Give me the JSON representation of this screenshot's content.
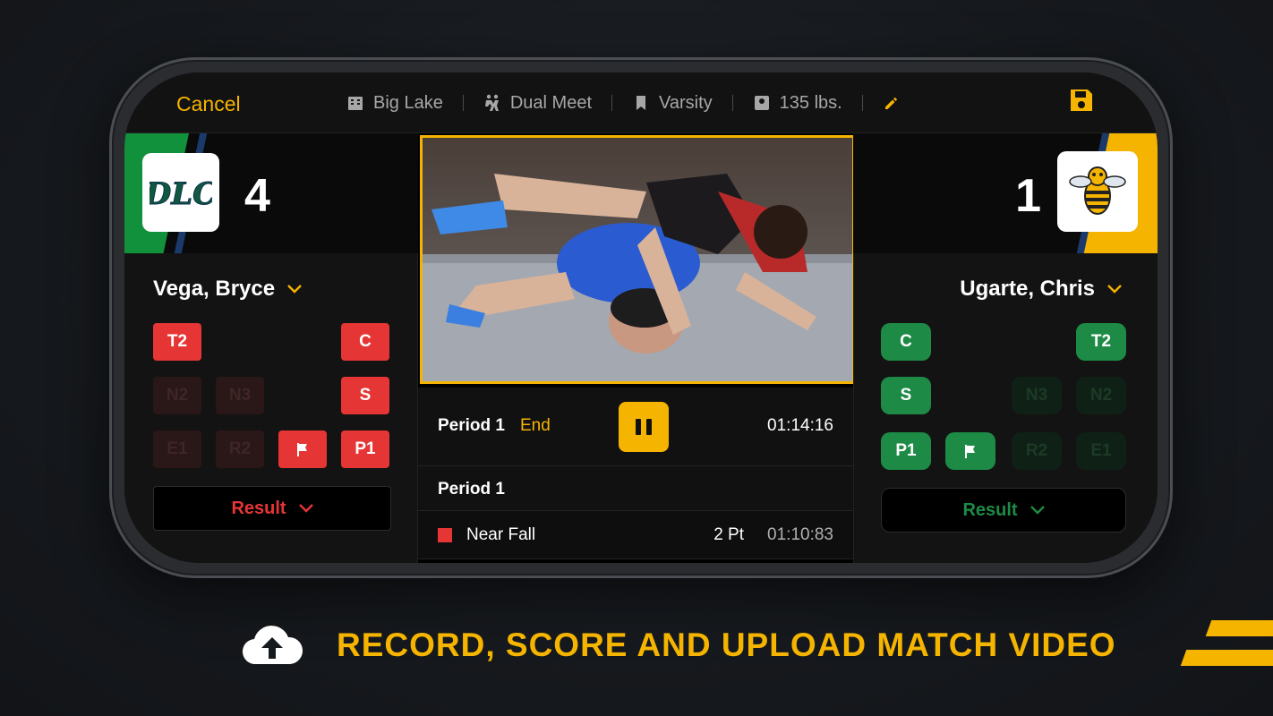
{
  "topbar": {
    "cancel": "Cancel",
    "school": "Big Lake",
    "meet_type": "Dual Meet",
    "level": "Varsity",
    "weight": "135 lbs.",
    "icons": [
      "building-icon",
      "wrestlers-icon",
      "bookmark-icon",
      "scale-icon",
      "pencil-icon",
      "save-icon"
    ]
  },
  "left_team": {
    "score": "4",
    "logo_text": "DLC",
    "wrestler": "Vega, Bryce",
    "color": "#e63535",
    "buttons": {
      "t2": "T2",
      "c": "C",
      "n2": "N2",
      "n3": "N3",
      "s": "S",
      "e1": "E1",
      "r2": "R2",
      "p1": "P1"
    },
    "result": "Result"
  },
  "right_team": {
    "score": "1",
    "wrestler": "Ugarte, Chris",
    "color": "#1d8b45",
    "buttons": {
      "c": "C",
      "t2": "T2",
      "s": "S",
      "n3": "N3",
      "n2": "N2",
      "p1": "P1",
      "r2": "R2",
      "e1": "E1"
    },
    "result": "Result"
  },
  "match": {
    "period": "Period 1",
    "end": "End",
    "clock": "01:14:16",
    "log_header": "Period 1",
    "log": [
      {
        "label": "Near Fall",
        "points": "2 Pt",
        "time": "01:10:83",
        "color": "#e63535"
      }
    ]
  },
  "caption": "RECORD, SCORE AND UPLOAD MATCH VIDEO",
  "accent": "#f5b400"
}
